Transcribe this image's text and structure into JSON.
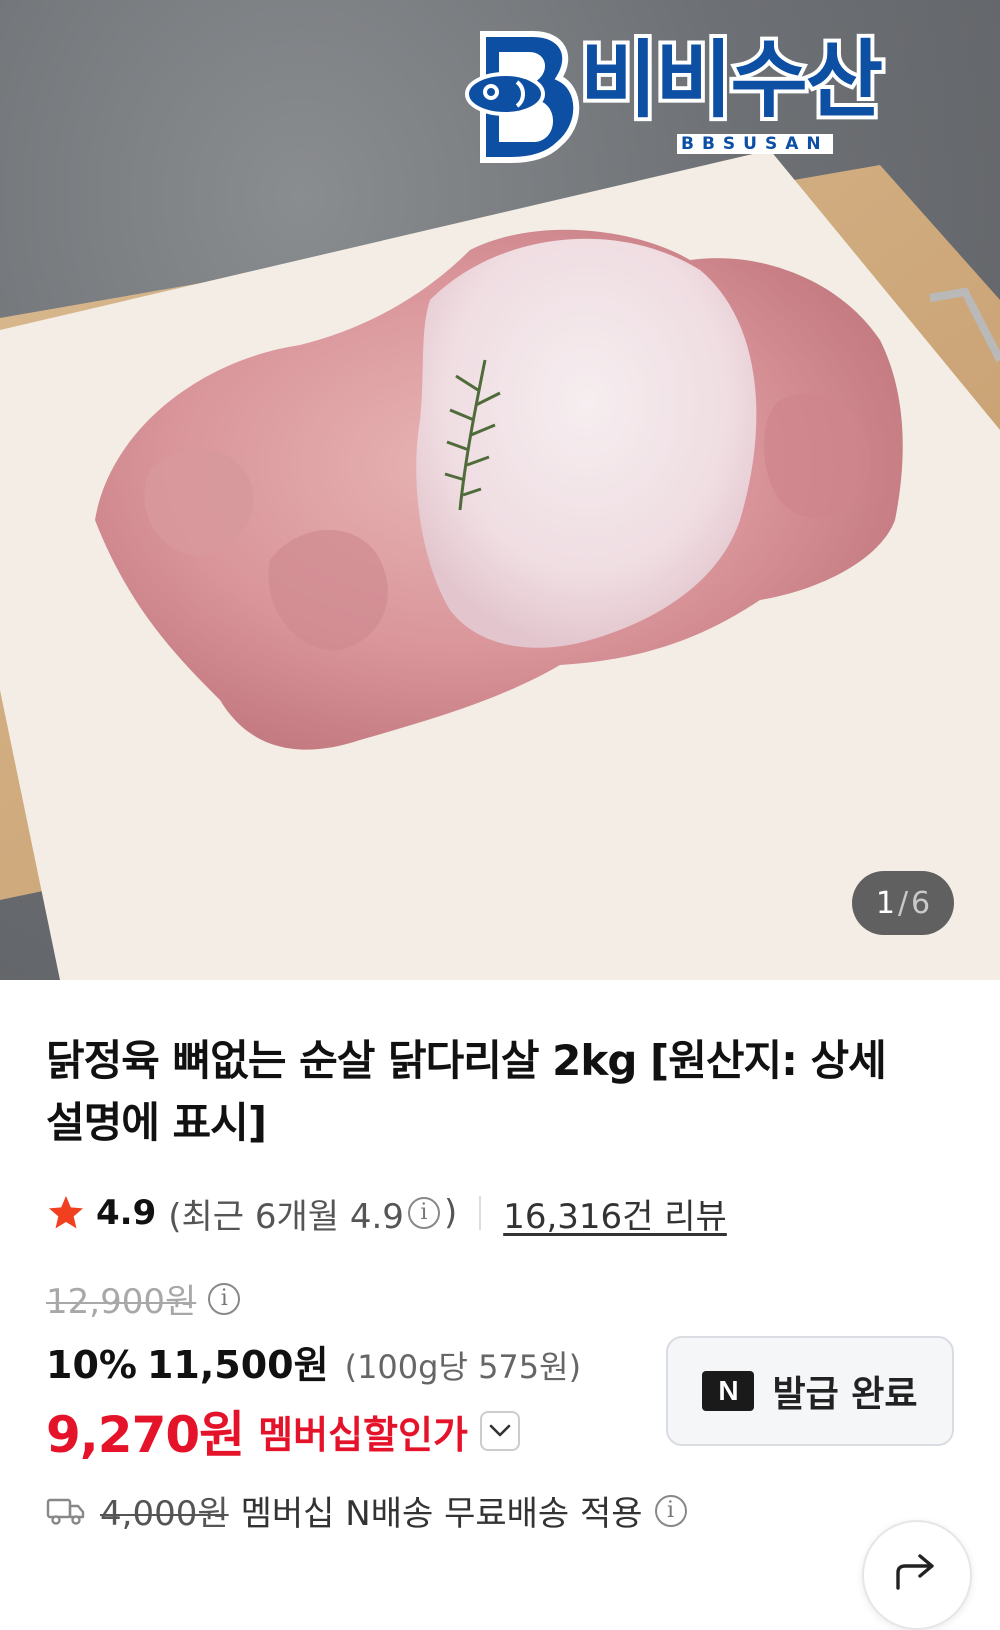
{
  "gallery": {
    "current": "1",
    "separator": "/",
    "total": "6",
    "logo": {
      "text": "비비수산",
      "subtext": "BBSUSAN",
      "color": "#0d4fa3"
    }
  },
  "product": {
    "title": "닭정육 뼈없는 순살 닭다리살 2kg [원산지: 상세설명에 표시]"
  },
  "rating": {
    "icon": "star-icon",
    "score": "4.9",
    "recent": "(최근 6개월 4.9",
    "recent_close": ")",
    "review_count": "16,316건 리뷰"
  },
  "price": {
    "original": "12,900원",
    "discount_percent": "10%",
    "sale_price": "11,500원",
    "unit_price": "(100g당 575원)",
    "member_price": "9,270원",
    "member_label": "멤버십할인가",
    "member_color": "#e5132a"
  },
  "coupon": {
    "badge": "N",
    "label": "발급 완료"
  },
  "shipping": {
    "icon": "truck-icon",
    "old_fee": "4,000원",
    "description": "멤버십 N배송 무료배송 적용"
  },
  "share": {
    "icon": "share-icon"
  }
}
